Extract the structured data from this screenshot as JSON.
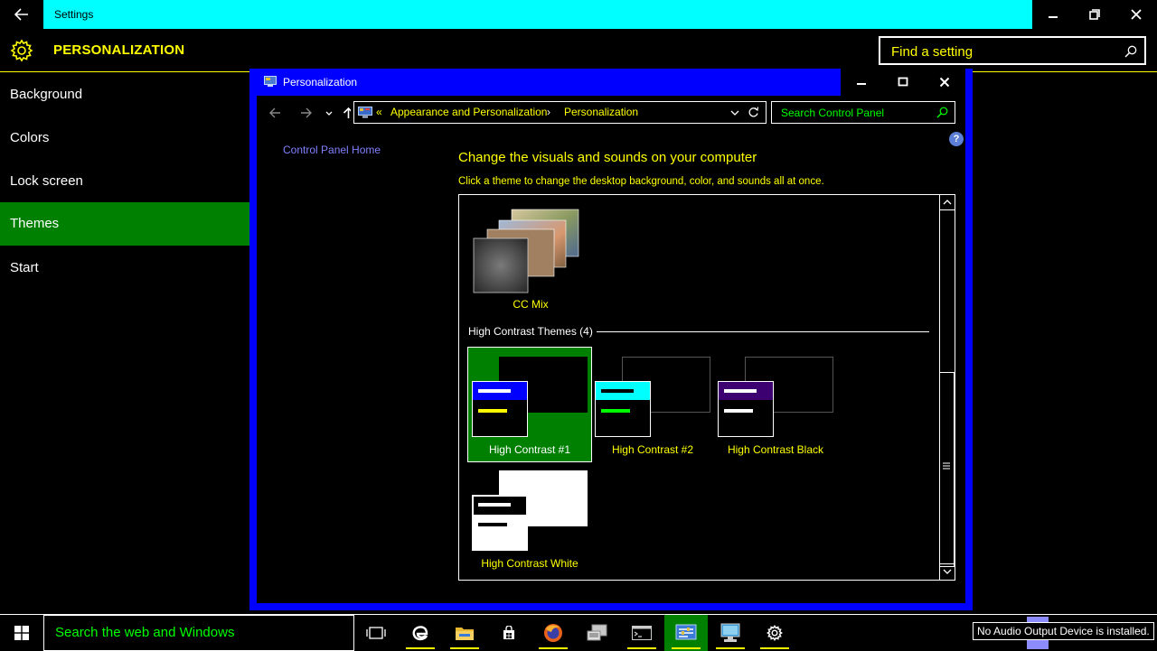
{
  "settings": {
    "window_title": "Settings",
    "page_title": "PERSONALIZATION",
    "search_placeholder": "Find a setting",
    "nav": [
      "Background",
      "Colors",
      "Lock screen",
      "Themes",
      "Start"
    ],
    "selected_nav": "Themes"
  },
  "control_panel": {
    "window_title": "Personalization",
    "breadcrumb": [
      "«",
      "Appearance and Personalization",
      "Personalization"
    ],
    "search_placeholder": "Search Control Panel",
    "home_link": "Control Panel Home",
    "heading": "Change the visuals and sounds on your computer",
    "subheading": "Click a theme to change the desktop background, color, and sounds all at once.",
    "help_glyph": "?",
    "my_themes": [
      {
        "name": "CC Mix"
      }
    ],
    "group_label": "High Contrast Themes (4)",
    "hc_themes": [
      {
        "name": "High Contrast #1",
        "selected": true,
        "header": "#0000ff",
        "bar1": "#ffffff",
        "bar2": "#ffff00"
      },
      {
        "name": "High Contrast #2",
        "selected": false,
        "header": "#00ffff",
        "bar1": "#000000",
        "bar2": "#00ff00"
      },
      {
        "name": "High Contrast Black",
        "selected": false,
        "header": "#3c0070",
        "bar1": "#ffffff",
        "bar2": "#ffffff"
      },
      {
        "name": "High Contrast White",
        "selected": false,
        "header": "#000000",
        "bar1": "#ffffff",
        "bar2": "#000000"
      }
    ]
  },
  "taskbar": {
    "search_text": "Search the web and Windows",
    "apps": [
      "task-view-icon",
      "edge-icon",
      "file-explorer-icon",
      "store-icon",
      "firefox-icon",
      "devices-icon",
      "cmd-icon",
      "control-panel-icon",
      "network-icon",
      "settings-gear-icon"
    ],
    "tooltip": "No Audio Output Device is installed."
  },
  "colors": {
    "title_cyan": "#00ffff",
    "accent_yellow": "#ffff00",
    "selected_green": "#008000",
    "window_blue": "#0000ff",
    "link_green": "#00ff00"
  }
}
